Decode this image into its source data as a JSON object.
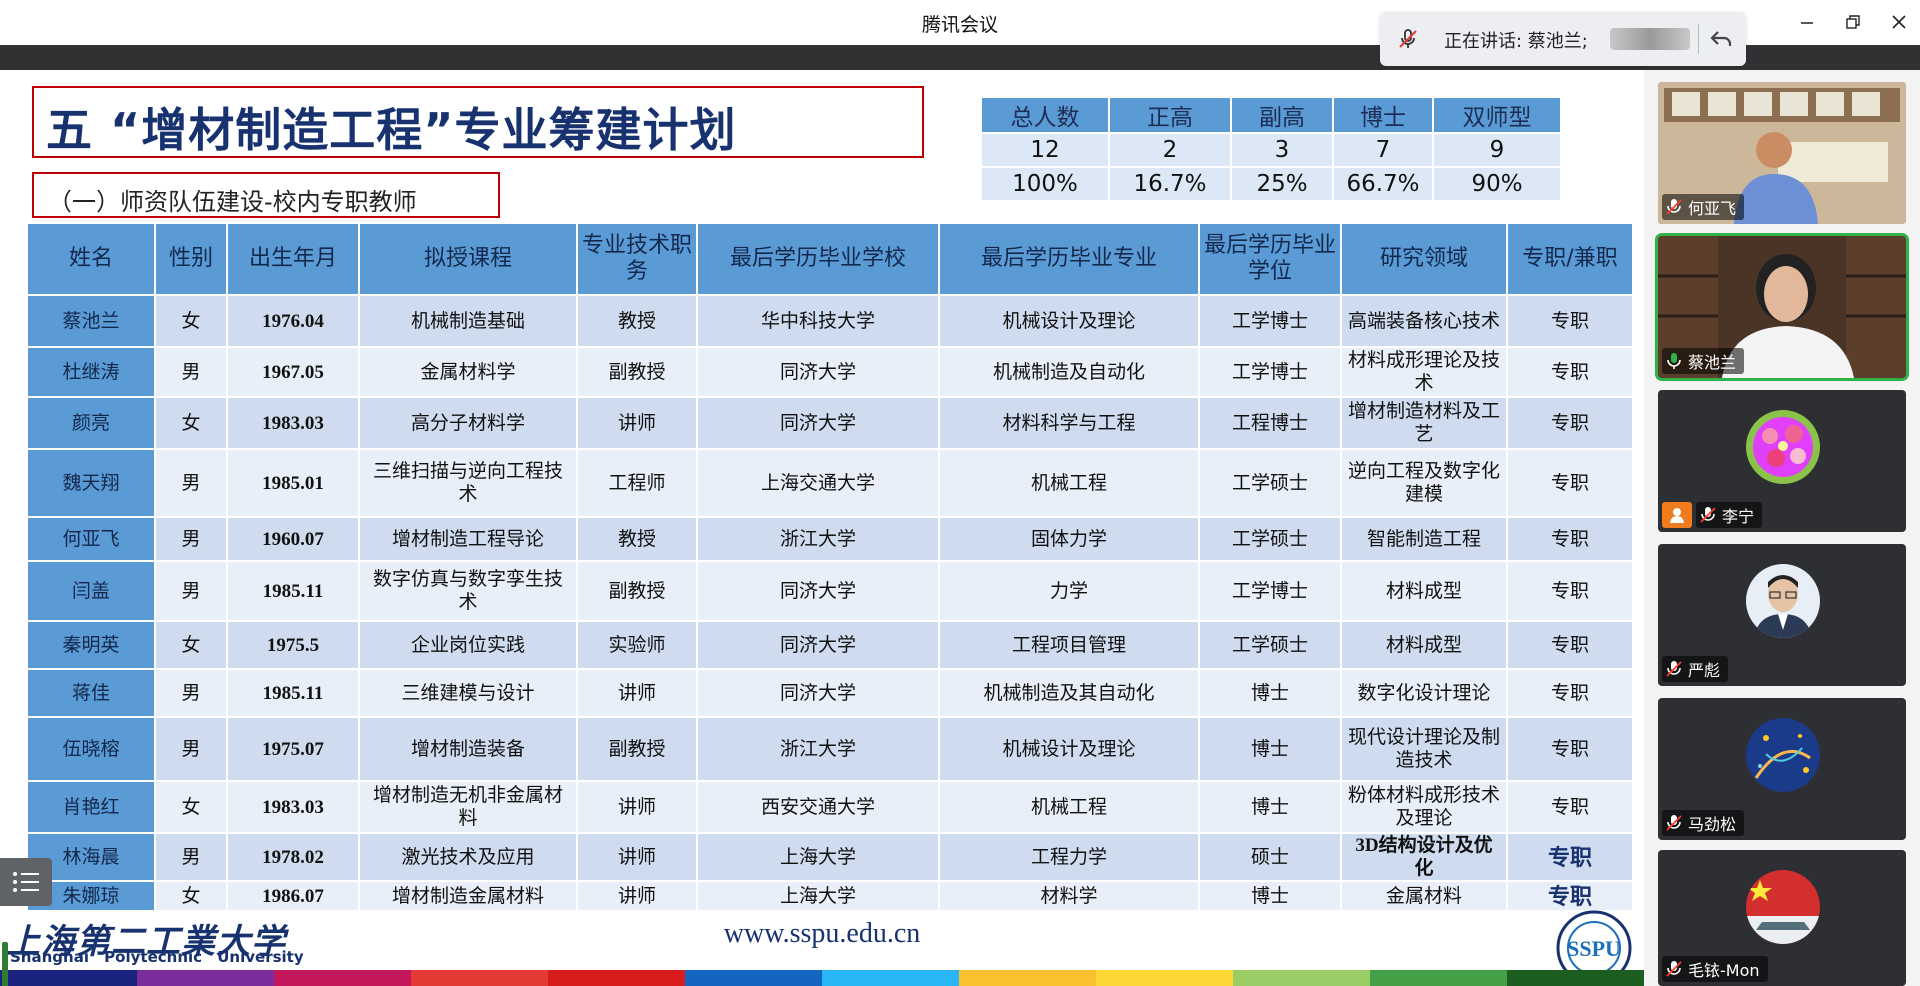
{
  "window": {
    "title": "腾讯会议"
  },
  "speaking": {
    "text": "正在讲话: 蔡池兰;"
  },
  "slide": {
    "title": "五 “增材制造工程”专业筹建计划",
    "subtitle": "（一）师资队伍建设-校内专职教师",
    "summary": {
      "headers": [
        "总人数",
        "正高",
        "副高",
        "博士",
        "双师型"
      ],
      "counts": [
        "12",
        "2",
        "3",
        "7",
        "9"
      ],
      "percents": [
        "100%",
        "16.7%",
        "25%",
        "66.7%",
        "90%"
      ]
    },
    "table": {
      "headers": [
        "姓名",
        "性别",
        "出生年月",
        "拟授课程",
        "专业技术职务",
        "最后学历毕业学校",
        "最后学历毕业专业",
        "最后学历毕业学位",
        "研究领域",
        "专职/兼职"
      ],
      "rows": [
        [
          "蔡池兰",
          "女",
          "1976.04",
          "机械制造基础",
          "教授",
          "华中科技大学",
          "机械设计及理论",
          "工学博士",
          "高端装备核心技术",
          "专职"
        ],
        [
          "杜继涛",
          "男",
          "1967.05",
          "金属材料学",
          "副教授",
          "同济大学",
          "机械制造及自动化",
          "工学博士",
          "材料成形理论及技术",
          "专职"
        ],
        [
          "颜亮",
          "女",
          "1983.03",
          "高分子材料学",
          "讲师",
          "同济大学",
          "材料科学与工程",
          "工程博士",
          "增材制造材料及工艺",
          "专职"
        ],
        [
          "魏天翔",
          "男",
          "1985.01",
          "三维扫描与逆向工程技术",
          "工程师",
          "上海交通大学",
          "机械工程",
          "工学硕士",
          "逆向工程及数字化建模",
          "专职"
        ],
        [
          "何亚飞",
          "男",
          "1960.07",
          "增材制造工程导论",
          "教授",
          "浙江大学",
          "固体力学",
          "工学硕士",
          "智能制造工程",
          "专职"
        ],
        [
          "闫盖",
          "男",
          "1985.11",
          "数字仿真与数字孪生技术",
          "副教授",
          "同济大学",
          "力学",
          "工学博士",
          "材料成型",
          "专职"
        ],
        [
          "秦明英",
          "女",
          "1975.5",
          "企业岗位实践",
          "实验师",
          "同济大学",
          "工程项目管理",
          "工学硕士",
          "材料成型",
          "专职"
        ],
        [
          "蒋佳",
          "男",
          "1985.11",
          "三维建模与设计",
          "讲师",
          "同济大学",
          "机械制造及其自动化",
          "博士",
          "数字化设计理论",
          "专职"
        ],
        [
          "伍晓榕",
          "男",
          "1975.07",
          "增材制造装备",
          "副教授",
          "浙江大学",
          "机械设计及理论",
          "博士",
          "现代设计理论及制造技术",
          "专职"
        ],
        [
          "肖艳红",
          "女",
          "1983.03",
          "增材制造无机非金属材料",
          "讲师",
          "西安交通大学",
          "机械工程",
          "博士",
          "粉体材料成形技术及理论",
          "专职"
        ],
        [
          "林海晨",
          "男",
          "1978.02",
          "激光技术及应用",
          "讲师",
          "上海大学",
          "工程力学",
          "硕士",
          "3D结构设计及优化",
          "专职"
        ],
        [
          "朱娜琼",
          "女",
          "1986.07",
          "增材制造金属材料",
          "讲师",
          "上海大学",
          "材料学",
          "博士",
          "金属材料",
          "专职"
        ]
      ]
    },
    "footer": {
      "logo_cn": "上海第二工業大学",
      "logo_en": "Shanghai Polytechnic University",
      "url": "www.sspu.edu.cn",
      "emblem": "SSPU"
    }
  },
  "participants": [
    {
      "name": "何亚飞"
    },
    {
      "name": "蔡池兰"
    },
    {
      "name": "李宁"
    },
    {
      "name": "严彪"
    },
    {
      "name": "马劲松"
    },
    {
      "name": "毛铱-Mon"
    }
  ],
  "colors": {
    "table_header": "#5b9bd5",
    "title_blue": "#17326f",
    "title_border": "#c00000",
    "active_speaker": "#2fb24a"
  }
}
